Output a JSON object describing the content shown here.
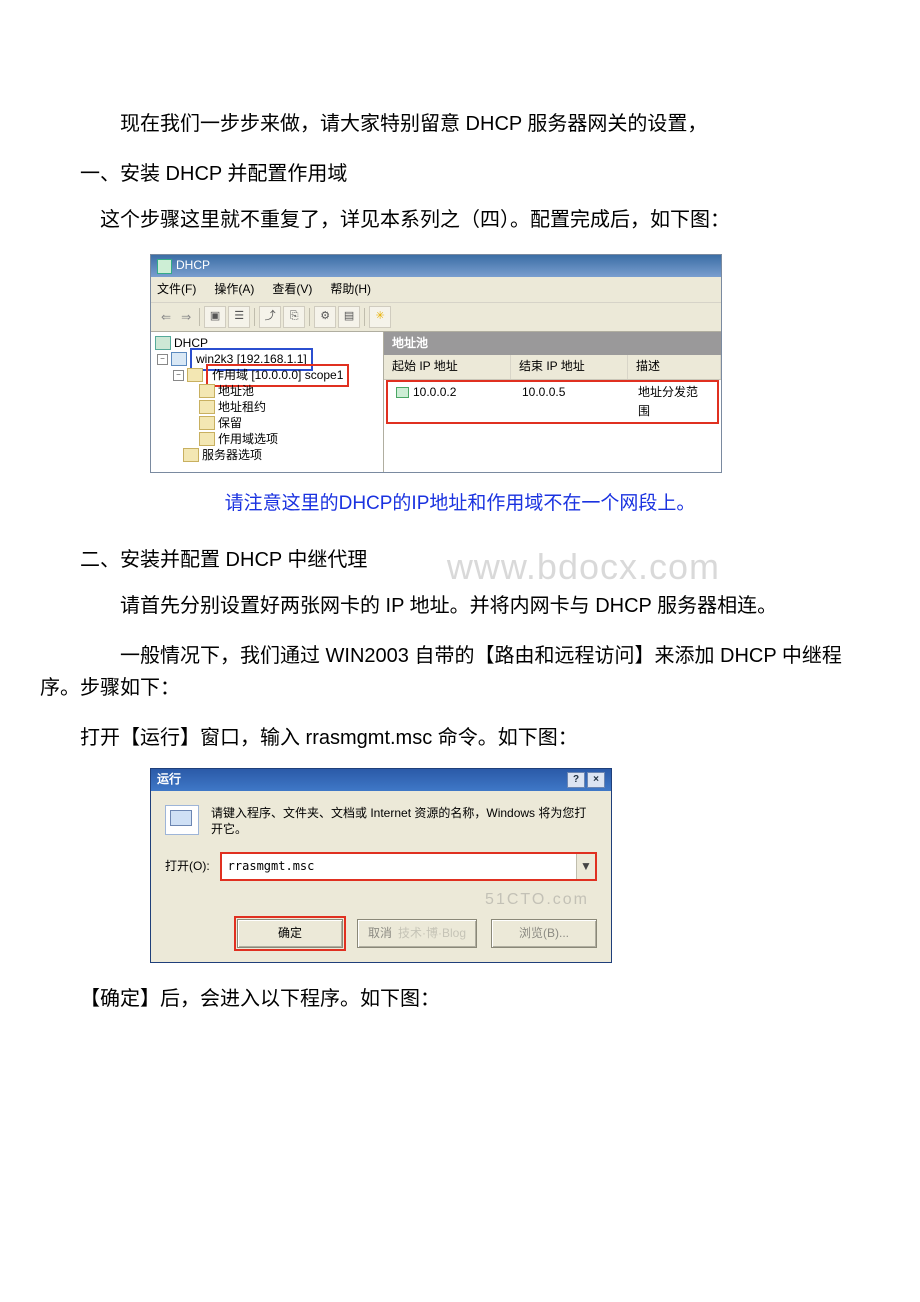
{
  "paragraphs": {
    "p1": "　　现在我们一步步来做，请大家特别留意 DHCP 服务器网关的设置，",
    "h1": "一、安装 DHCP 并配置作用域",
    "p2": "　这个步骤这里就不重复了，详见本系列之（四）。配置完成后，如下图：",
    "note": "请注意这里的DHCP的IP地址和作用域不在一个网段上。",
    "h2": "二、安装并配置 DHCP 中继代理",
    "p3": "　　请首先分别设置好两张网卡的 IP 地址。并将内网卡与 DHCP 服务器相连。",
    "p4": "　　一般情况下，我们通过 WIN2003 自带的【路由和远程访问】来添加 DHCP 中继程序。步骤如下：",
    "p5": "打开【运行】窗口，输入 rrasmgmt.msc 命令。如下图：",
    "p6": "【确定】后，会进入以下程序。如下图："
  },
  "dhcp": {
    "title": "DHCP",
    "menu": {
      "file": "文件(F)",
      "action": "操作(A)",
      "view": "查看(V)",
      "help": "帮助(H)"
    },
    "tree": {
      "root": "DHCP",
      "server": "win2k3 [192.168.1.1]",
      "scope": "作用域 [10.0.0.0] scope1",
      "nodes": {
        "pool": "地址池",
        "lease": "地址租约",
        "res": "保留",
        "scopeopt": "作用域选项",
        "srvopt": "服务器选项"
      }
    },
    "list": {
      "title": "地址池",
      "cols": {
        "c1": "起始 IP 地址",
        "c2": "结束 IP 地址",
        "c3": "描述"
      },
      "row1": {
        "c1": "10.0.0.2",
        "c2": "10.0.0.5",
        "c3": "地址分发范围"
      }
    }
  },
  "run": {
    "title": "运行",
    "msg": "请键入程序、文件夹、文档或 Internet 资源的名称，Windows 将为您打开它。",
    "open_label": "打开(O):",
    "value": "rrasmgmt.msc",
    "buttons": {
      "ok": "确定",
      "cancel": "取消",
      "browse": "浏览(B)..."
    },
    "wm1": "51CTO.com",
    "wm2": "技术·博·Blog"
  },
  "watermark": "www.bdocx.com"
}
